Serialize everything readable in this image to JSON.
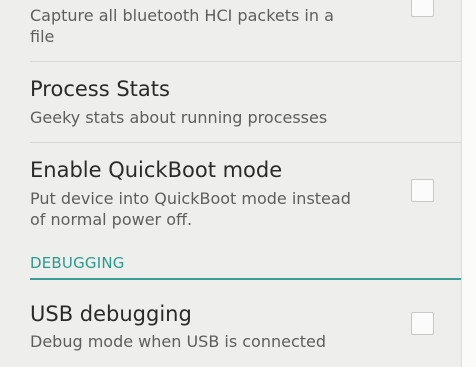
{
  "settings": {
    "bluetooth_hci": {
      "summary_line1": "Capture all bluetooth HCI packets in a",
      "summary_line2": "file",
      "checked": false
    },
    "process_stats": {
      "title": "Process Stats",
      "summary": "Geeky stats about running processes"
    },
    "quickboot": {
      "title": "Enable QuickBoot mode",
      "summary_line1": "Put device into QuickBoot mode instead",
      "summary_line2": "of normal power off.",
      "checked": false
    },
    "debugging_category": "DEBUGGING",
    "usb_debugging": {
      "title": "USB debugging",
      "summary": "Debug mode when USB is connected",
      "checked": false
    }
  },
  "colors": {
    "accent": "#2a9a90",
    "background": "#eeeeec",
    "title_text": "#2a2a2a",
    "summary_text": "#5e5e5e"
  }
}
